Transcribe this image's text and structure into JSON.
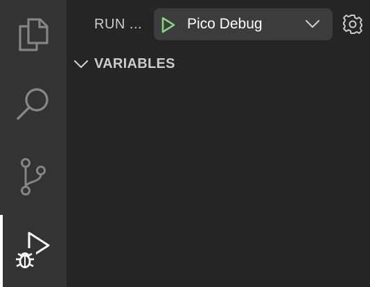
{
  "activity_bar": {
    "items": [
      {
        "name": "explorer",
        "icon": "files-icon"
      },
      {
        "name": "search",
        "icon": "search-icon"
      },
      {
        "name": "source-control",
        "icon": "source-control-icon"
      },
      {
        "name": "run-and-debug",
        "icon": "run-debug-icon",
        "active": true
      }
    ]
  },
  "sidebar": {
    "header_title": "RUN ...",
    "launch_config": {
      "selected": "Pico Debug",
      "play_color": "#89d185"
    },
    "sections": [
      {
        "title": "VARIABLES",
        "expanded": true
      }
    ]
  },
  "colors": {
    "activity_bar_bg": "#333333",
    "sidebar_bg": "#252526",
    "select_bg": "#3c3c3c",
    "play_green": "#89d185"
  }
}
